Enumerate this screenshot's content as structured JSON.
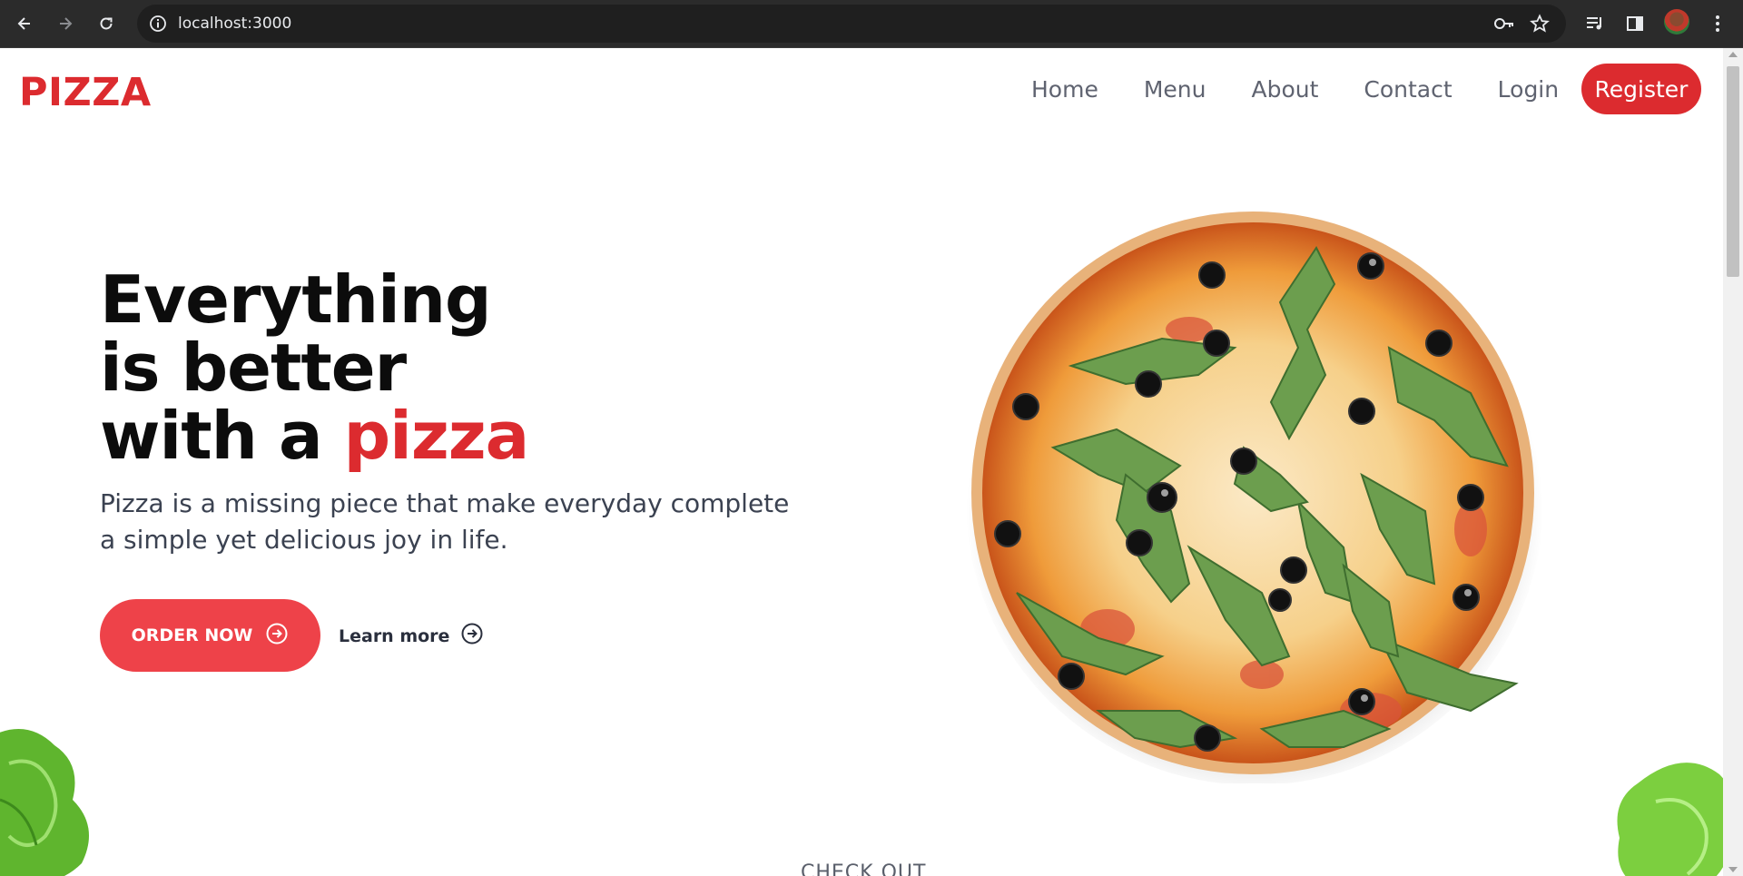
{
  "browser": {
    "url": "localhost:3000"
  },
  "nav": {
    "logo": "PIZZA",
    "links": [
      "Home",
      "Menu",
      "About",
      "Contact",
      "Login"
    ],
    "register_label": "Register"
  },
  "hero": {
    "title_line1": "Everything",
    "title_line2": "is better",
    "title_line3_prefix": "with a ",
    "title_line3_accent": "pizza",
    "subtitle": "Pizza is a missing piece that make everyday complete a simple yet delicious joy in life.",
    "order_label": "ORDER NOW",
    "learn_label": "Learn more"
  },
  "section_peek": {
    "label": "CHECK OUT"
  },
  "colors": {
    "brand_red": "#dc2b2f",
    "button_red": "#ee4249",
    "nav_text": "#5f6370",
    "chrome_bg": "#2b2b2b"
  },
  "icons": [
    "back-arrow-icon",
    "forward-arrow-icon",
    "reload-icon",
    "info-icon",
    "key-icon",
    "star-icon",
    "media-control-icon",
    "side-panel-icon",
    "kebab-menu-icon",
    "arrow-circle-right-icon"
  ]
}
